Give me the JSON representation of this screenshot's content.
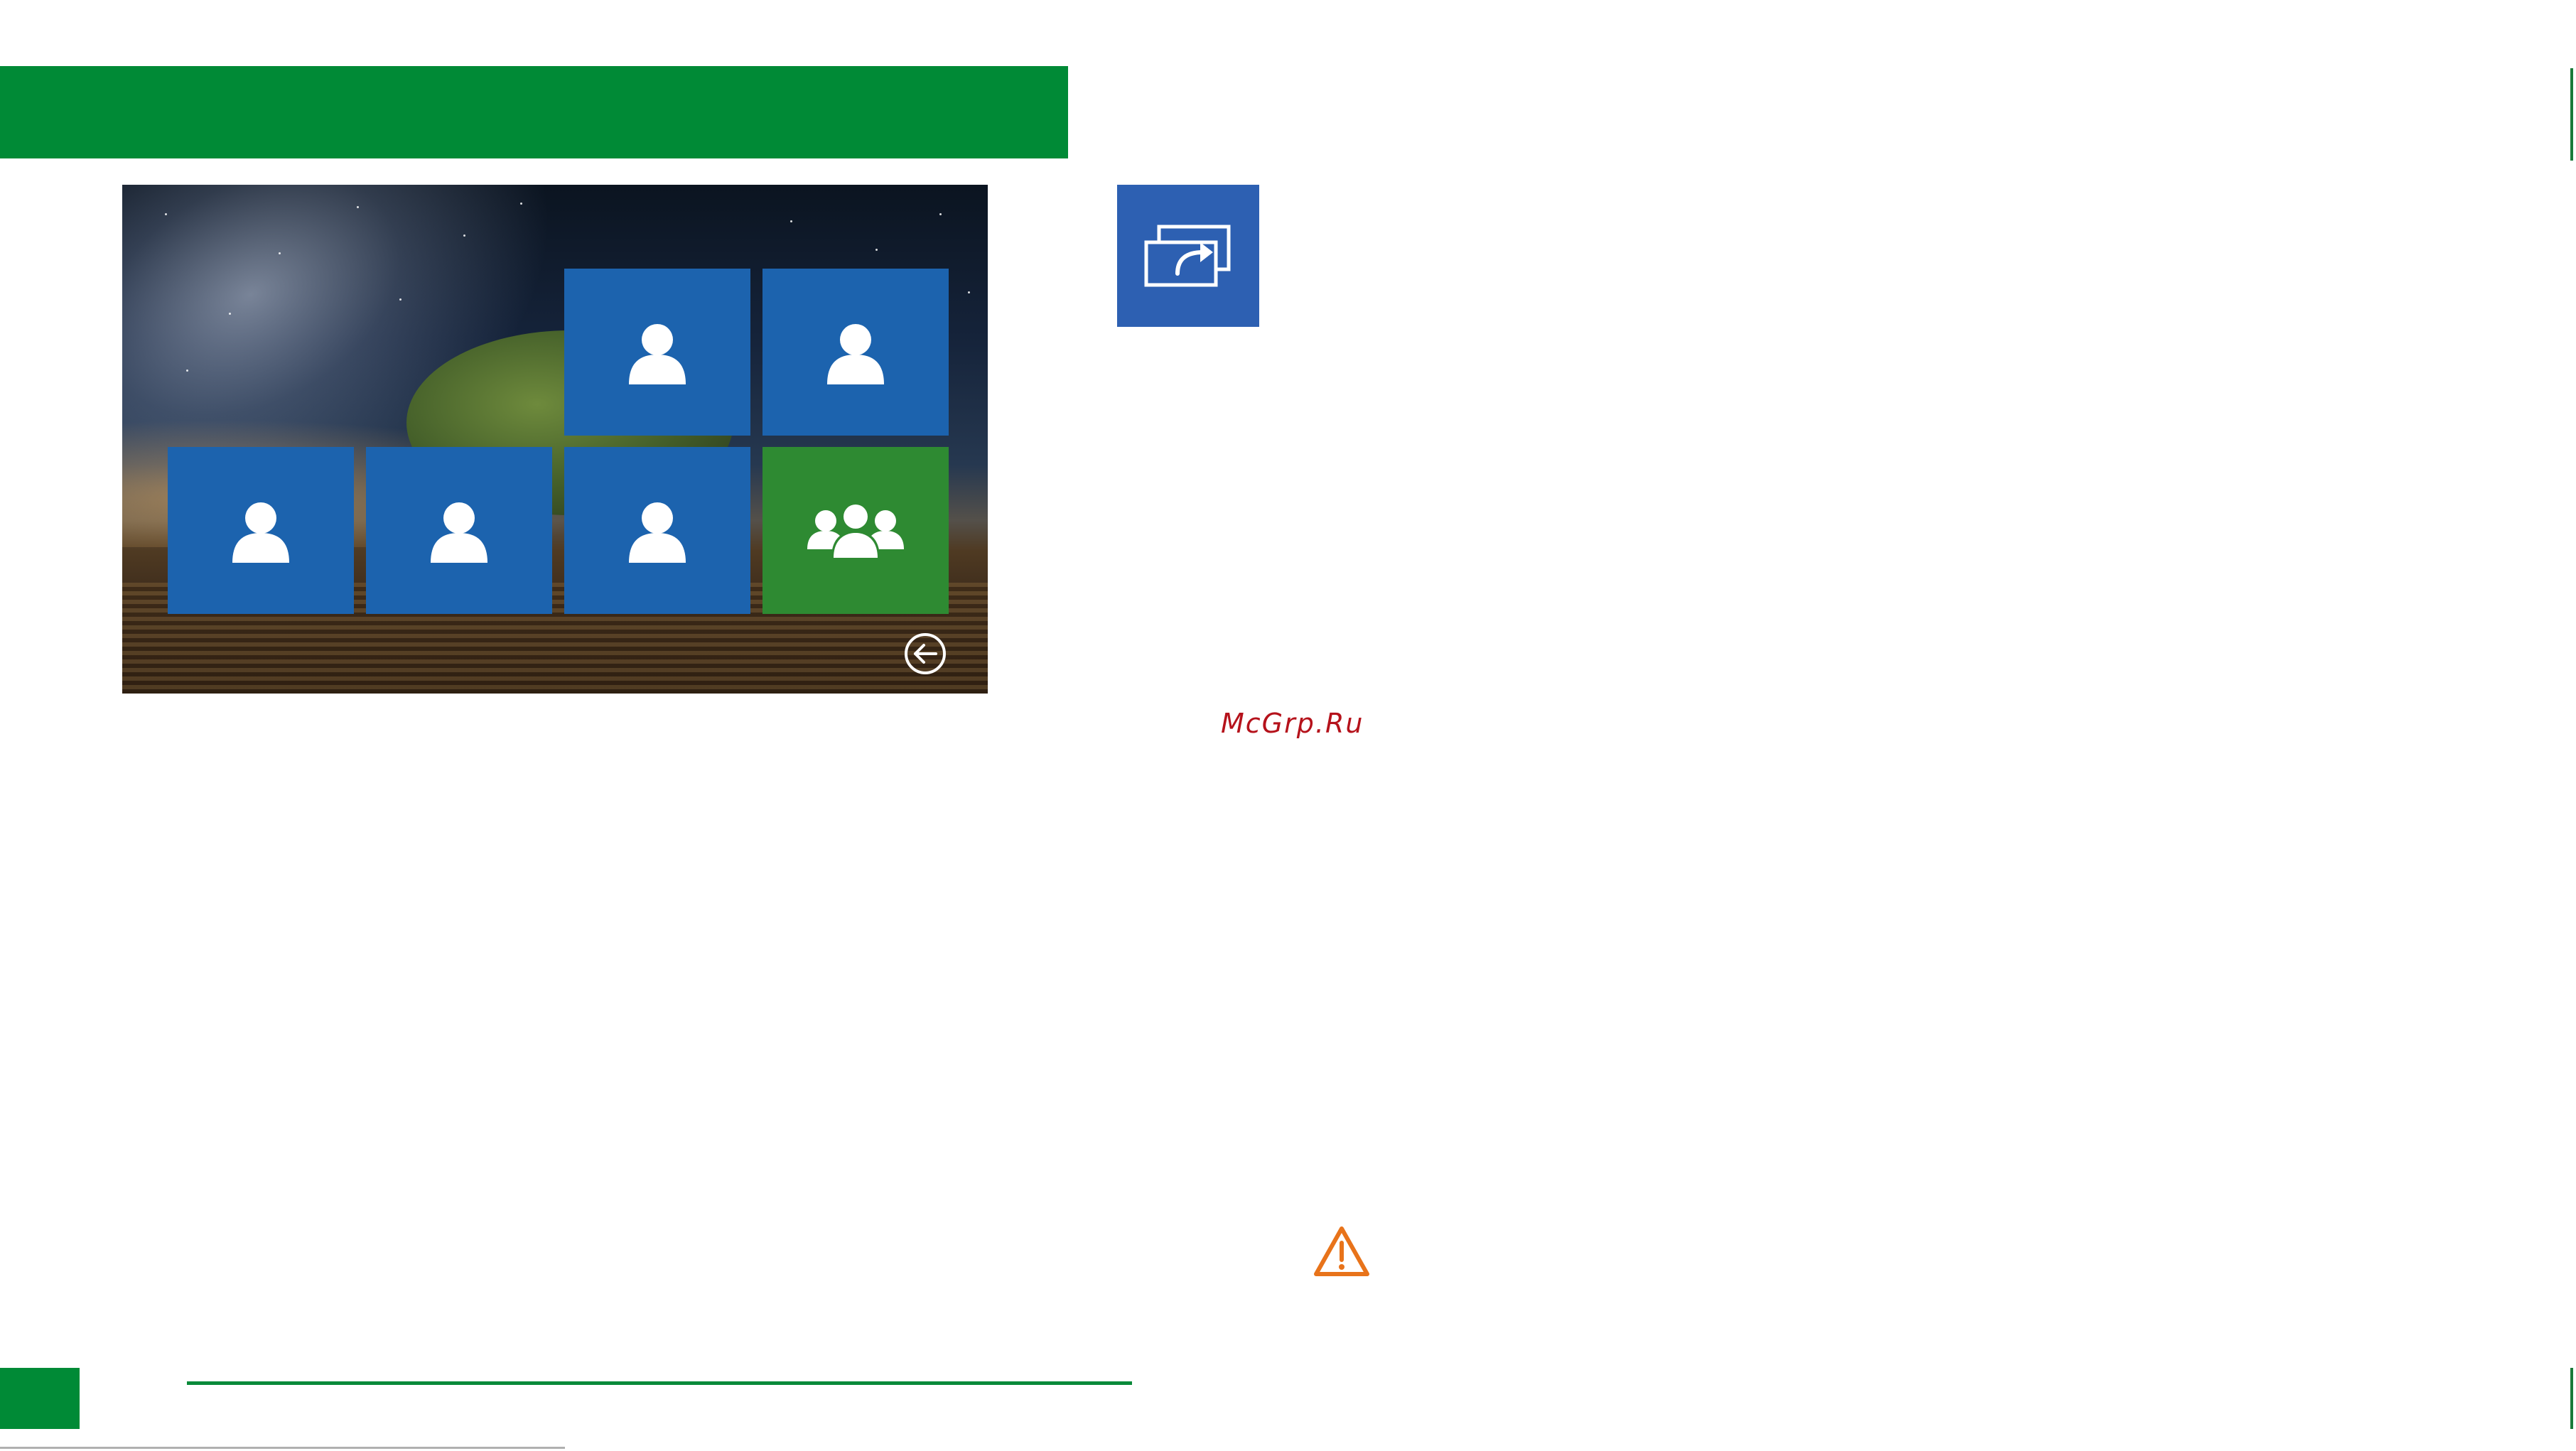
{
  "watermark": {
    "text": "McGrp.Ru",
    "color": "#b5121b"
  },
  "colors": {
    "header_green": "#008a36",
    "tile_blue": "#1c63ae",
    "tile_group_green": "#2e8a32",
    "forward_tile_blue": "#2d60b2",
    "warning_orange": "#e8731a"
  },
  "screen": {
    "contact_tiles": [
      {
        "icon": "user-icon"
      },
      {
        "icon": "user-icon"
      },
      {
        "icon": "user-icon"
      },
      {
        "icon": "user-icon"
      },
      {
        "icon": "user-icon"
      }
    ],
    "group_tile": {
      "icon": "group-icon"
    },
    "back_button": {
      "icon": "back-arrow-icon"
    }
  },
  "side_icon": {
    "icon": "call-forward-icon"
  },
  "warning_icon": {
    "icon": "warning-icon"
  }
}
